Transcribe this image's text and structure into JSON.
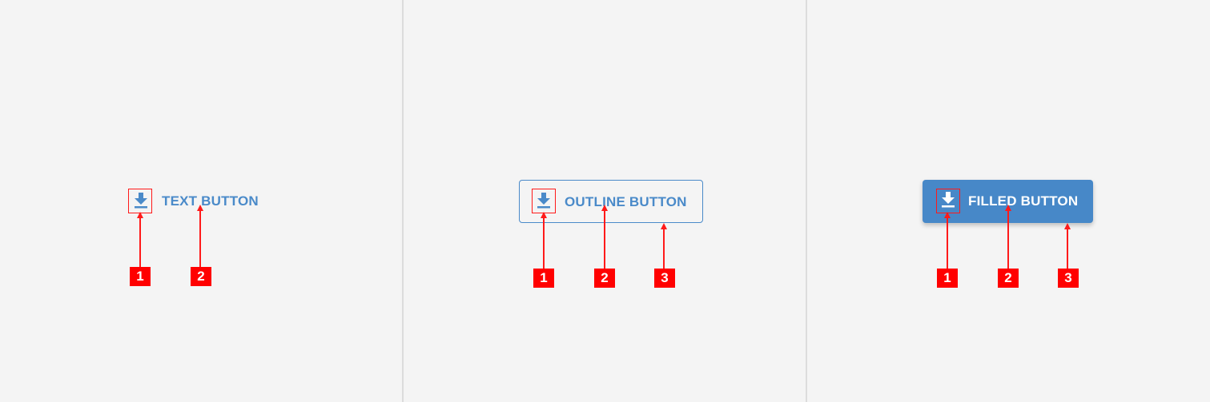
{
  "colors": {
    "background": "#f4f4f4",
    "divider": "#dcdcdc",
    "primary": "#4788c8",
    "annotation": "#ff0000",
    "on_primary": "#ffffff"
  },
  "panels": [
    {
      "variant": "text",
      "button": {
        "label": "TEXT BUTTON",
        "icon": "download-icon"
      },
      "markers": [
        "1",
        "2"
      ]
    },
    {
      "variant": "outline",
      "button": {
        "label": "OUTLINE BUTTON",
        "icon": "download-icon"
      },
      "markers": [
        "1",
        "2",
        "3"
      ]
    },
    {
      "variant": "filled",
      "button": {
        "label": "FILLED BUTTON",
        "icon": "download-icon"
      },
      "markers": [
        "1",
        "2",
        "3"
      ]
    }
  ]
}
